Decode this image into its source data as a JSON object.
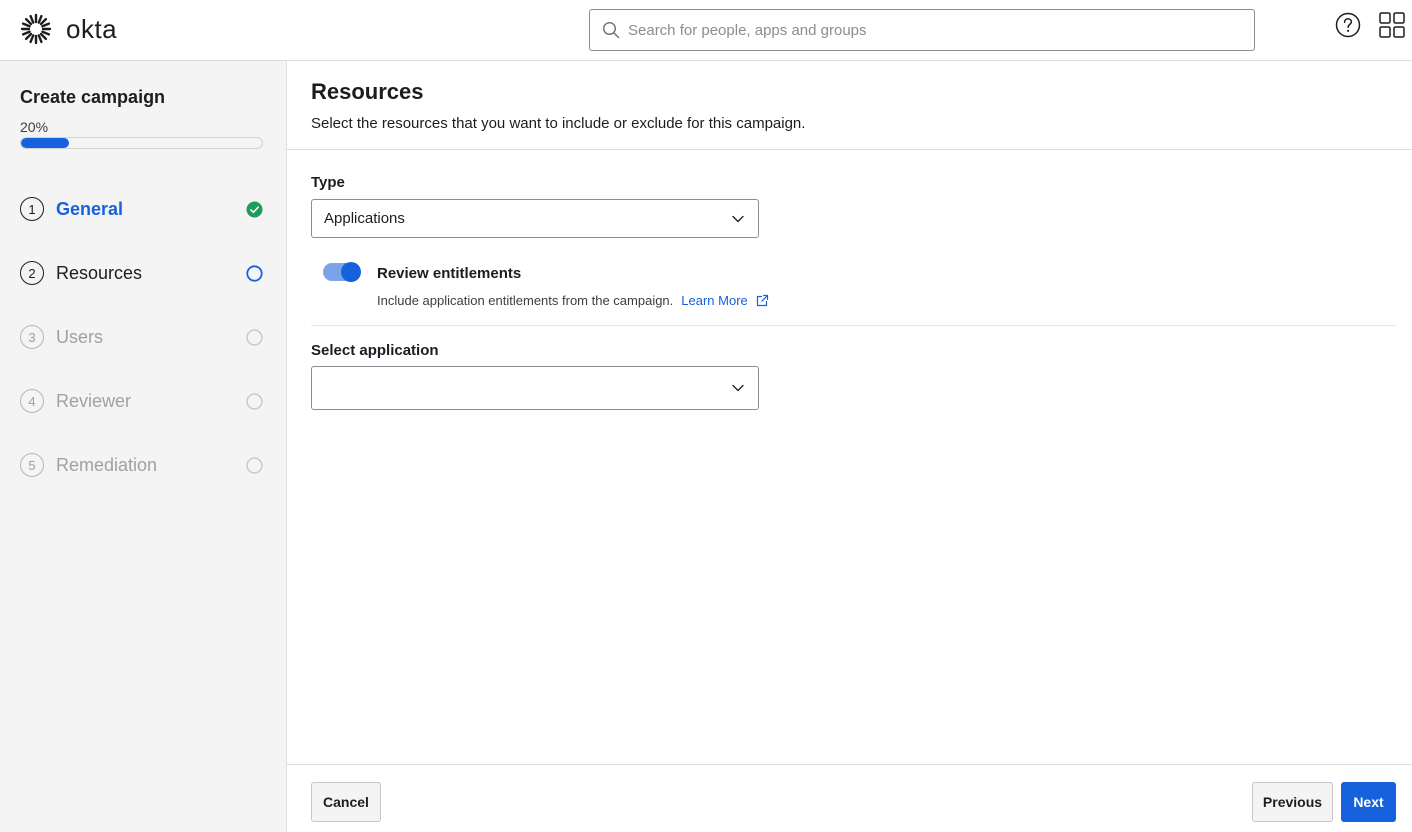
{
  "header": {
    "logo_text": "okta",
    "search_placeholder": "Search for people, apps and groups",
    "help_icon": "help-circle-icon",
    "apps_icon": "app-grid-icon"
  },
  "sidebar": {
    "title": "Create campaign",
    "progress_label": "20%",
    "progress_value": 0.2,
    "steps": [
      {
        "number": "1",
        "label": "General",
        "state": "completed"
      },
      {
        "number": "2",
        "label": "Resources",
        "state": "current"
      },
      {
        "number": "3",
        "label": "Users",
        "state": "disabled"
      },
      {
        "number": "4",
        "label": "Reviewer",
        "state": "disabled"
      },
      {
        "number": "5",
        "label": "Remediation",
        "state": "disabled"
      }
    ]
  },
  "main": {
    "title": "Resources",
    "subtitle": "Select the resources that you want to include or exclude for this campaign.",
    "type_label": "Type",
    "type_value": "Applications",
    "toggle_label": "Review entitlements",
    "toggle_on": true,
    "toggle_description": "Include application entitlements from the campaign.",
    "learn_more": "Learn More",
    "select_app_label": "Select application",
    "select_app_value": ""
  },
  "footer": {
    "cancel": "Cancel",
    "previous": "Previous",
    "next": "Next"
  },
  "colors": {
    "primary": "#1662dd",
    "success": "#1f9c5a",
    "toggle_track": "#7aa3ea"
  }
}
